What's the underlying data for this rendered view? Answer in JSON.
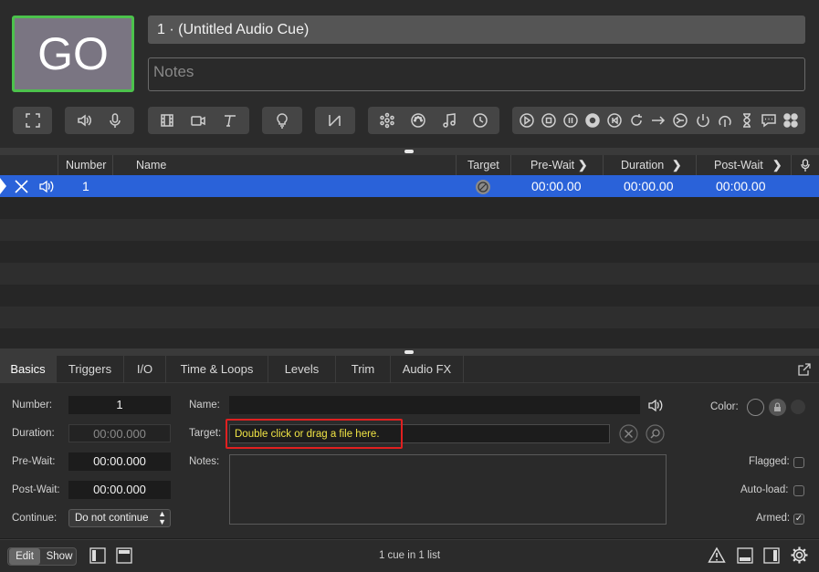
{
  "go_button": {
    "label": "GO"
  },
  "cue": {
    "title": "1 · (Untitled Audio Cue)",
    "notes_placeholder": "Notes"
  },
  "table": {
    "headers": {
      "number": "Number",
      "name": "Name",
      "target": "Target",
      "pre_wait": "Pre-Wait",
      "duration": "Duration",
      "post_wait": "Post-Wait"
    },
    "selected_row": {
      "number": "1",
      "pre_wait": "00:00.00",
      "duration": "00:00.00",
      "post_wait": "00:00.00"
    }
  },
  "tabs": [
    "Basics",
    "Triggers",
    "I/O",
    "Time & Loops",
    "Levels",
    "Trim",
    "Audio FX"
  ],
  "inspector": {
    "number_label": "Number:",
    "number_value": "1",
    "duration_label": "Duration:",
    "duration_value": "00:00.000",
    "prewait_label": "Pre-Wait:",
    "prewait_value": "00:00.000",
    "postwait_label": "Post-Wait:",
    "postwait_value": "00:00.000",
    "continue_label": "Continue:",
    "continue_value": "Do not continue",
    "name_label": "Name:",
    "target_label": "Target:",
    "target_hint": "Double click or drag a file here.",
    "notes_label": "Notes:",
    "color_label": "Color:",
    "flagged_label": "Flagged:",
    "autoload_label": "Auto-load:",
    "armed_label": "Armed:"
  },
  "footer": {
    "edit": "Edit",
    "show": "Show",
    "status": "1 cue in 1 list"
  },
  "colors": {
    "go_border": "#4cc24c",
    "selection": "#2a62d9",
    "hint": "#f0e445",
    "highlight": "#e02020"
  }
}
